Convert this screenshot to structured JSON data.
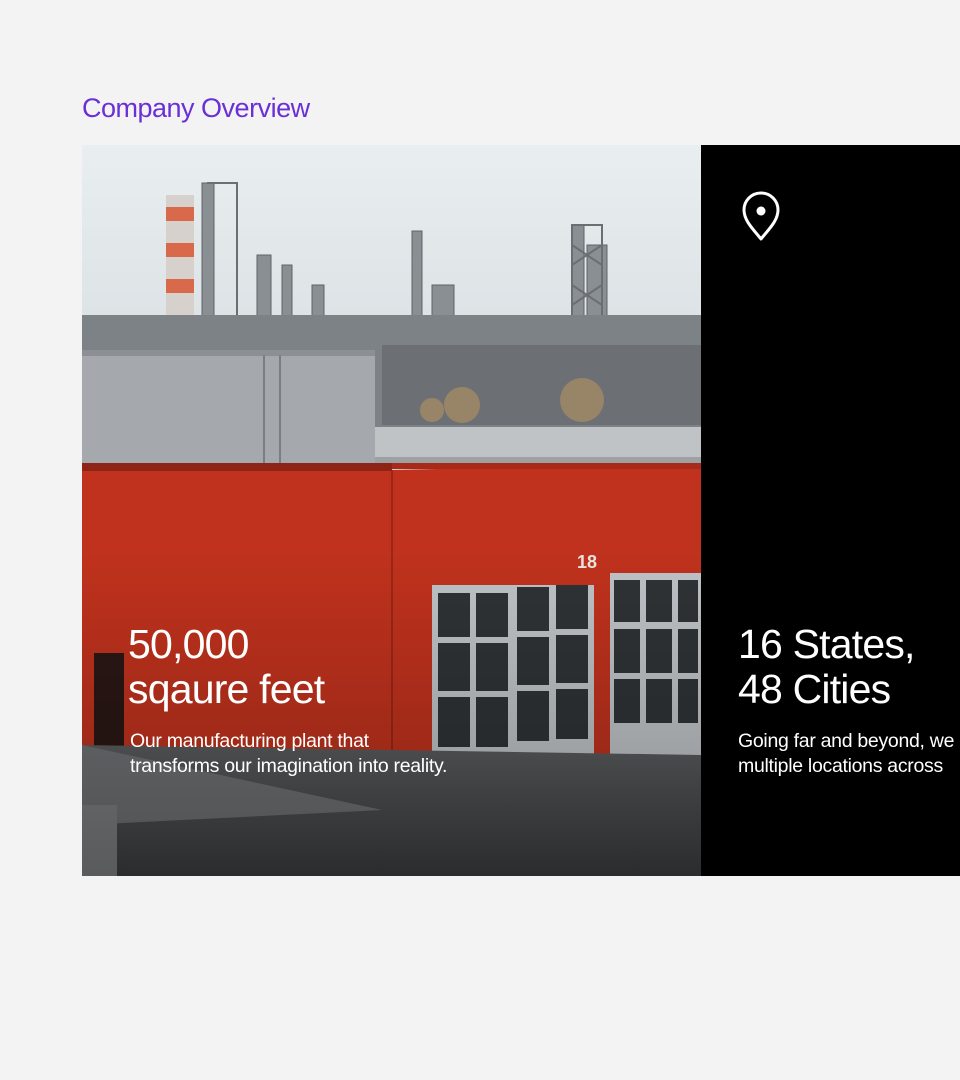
{
  "section": {
    "title": "Company Overview"
  },
  "cards": [
    {
      "heading_line1": "50,000",
      "heading_line2": "sqaure feet",
      "desc_line1": "Our manufacturing plant that",
      "desc_line2": "transforms our imagination into reality.",
      "building_number": "18",
      "image": "factory-photo"
    },
    {
      "icon": "location-pin-icon",
      "heading_line1": "16 States,",
      "heading_line2": "48 Cities",
      "desc_line1": "Going far and beyond, we",
      "desc_line2": "multiple locations across"
    }
  ],
  "colors": {
    "background": "#f3f3f3",
    "title_accent": "#6a2fd6",
    "dark_card": "#000000",
    "text_on_card": "#ffffff"
  }
}
